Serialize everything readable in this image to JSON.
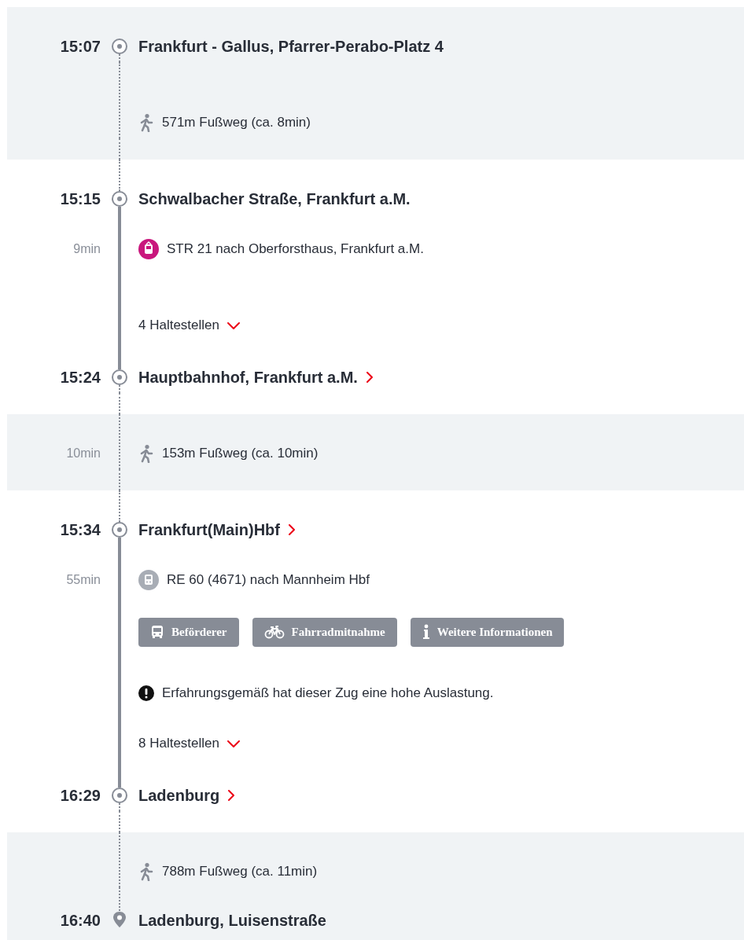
{
  "sections": [
    {
      "kind": "walk",
      "rows": [
        {
          "kind": "stop",
          "time": "15:07",
          "name": "Frankfurt - Gallus, Pfarrer-Perabo-Platz 4",
          "link": false
        },
        {
          "kind": "walk",
          "text": "571m Fußweg (ca. 8min)"
        }
      ]
    },
    {
      "kind": "transit",
      "rows": [
        {
          "kind": "stop",
          "time": "15:15",
          "name": "Schwalbacher Straße, Frankfurt a.M.",
          "link": false
        },
        {
          "kind": "tram",
          "duration": "9min",
          "color": "#c9177d",
          "text": "STR 21 nach Oberforsthaus, Frankfurt a.M."
        },
        {
          "kind": "toggle",
          "text": "4 Haltestellen",
          "expanded": false
        },
        {
          "kind": "stop",
          "time": "15:24",
          "name": "Hauptbahnhof, Frankfurt a.M.",
          "link": true
        }
      ]
    },
    {
      "kind": "walk",
      "rows": [
        {
          "kind": "walk",
          "duration": "10min",
          "text": "153m Fußweg (ca. 10min)"
        }
      ]
    },
    {
      "kind": "transit",
      "rows": [
        {
          "kind": "stop",
          "time": "15:34",
          "name": "Frankfurt(Main)Hbf",
          "link": true
        },
        {
          "kind": "train",
          "duration": "55min",
          "color": "#a8adb5",
          "text": "RE 60 (4671) nach Mannheim Hbf"
        },
        {
          "kind": "buttons",
          "buttons": [
            "Beförderer",
            "Fahrradmitnahme",
            "Weitere Informationen"
          ]
        },
        {
          "kind": "notice",
          "text": "Erfahrungsgemäß hat dieser Zug eine hohe Auslastung."
        },
        {
          "kind": "toggle",
          "text": "8 Haltestellen",
          "expanded": false
        },
        {
          "kind": "stop",
          "time": "16:29",
          "name": "Ladenburg",
          "link": true
        }
      ]
    },
    {
      "kind": "walk",
      "rows": [
        {
          "kind": "walk",
          "text": "788m Fußweg (ca. 11min)"
        },
        {
          "kind": "destination",
          "time": "16:40",
          "name": "Ladenburg, Luisenstraße",
          "link": false
        }
      ]
    }
  ]
}
